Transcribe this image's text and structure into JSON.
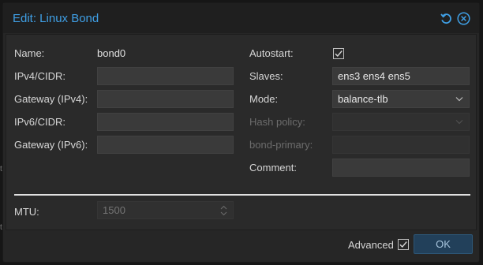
{
  "dialog": {
    "title": "Edit: Linux Bond",
    "reset_icon": "reset-icon",
    "close_icon": "close-icon"
  },
  "background": {
    "edge_chars": [
      "t",
      "t"
    ]
  },
  "left": {
    "name_label": "Name:",
    "name_value": "bond0",
    "ipv4_label": "IPv4/CIDR:",
    "ipv4_value": "",
    "gw4_label": "Gateway (IPv4):",
    "gw4_value": "",
    "ipv6_label": "IPv6/CIDR:",
    "ipv6_value": "",
    "gw6_label": "Gateway (IPv6):",
    "gw6_value": ""
  },
  "right": {
    "autostart_label": "Autostart:",
    "autostart_checked": true,
    "slaves_label": "Slaves:",
    "slaves_value": "ens3 ens4 ens5",
    "mode_label": "Mode:",
    "mode_value": "balance-tlb",
    "hash_label": "Hash policy:",
    "hash_value": "",
    "primary_label": "bond-primary:",
    "primary_value": "",
    "comment_label": "Comment:",
    "comment_value": ""
  },
  "advanced": {
    "mtu_label": "MTU:",
    "mtu_placeholder": "1500"
  },
  "footer": {
    "advanced_label": "Advanced",
    "advanced_checked": true,
    "ok_label": "OK"
  },
  "colors": {
    "accent": "#3f9fe5",
    "ok_background": "#22405a",
    "field_background": "#3a3a3a"
  }
}
